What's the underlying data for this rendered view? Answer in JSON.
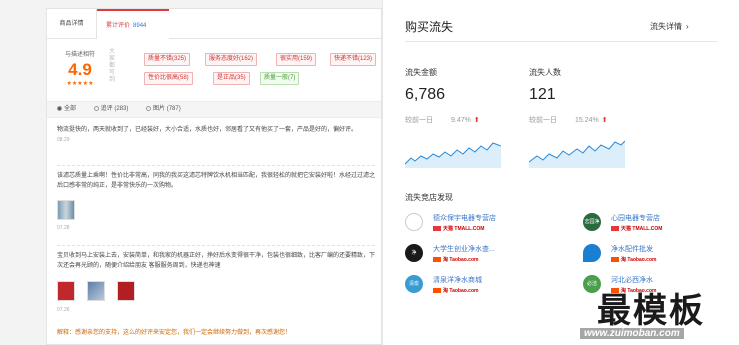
{
  "left_panel": {
    "tabs": [
      {
        "label": "商品详情"
      },
      {
        "label": "累计评价",
        "count": "8944"
      }
    ],
    "score": {
      "label": "与描述相符",
      "value": "4.9",
      "stars": "★★★★★"
    },
    "side_text": "大家都写到",
    "chips": [
      {
        "label": "质量不错(325)",
        "kind": "bad"
      },
      {
        "label": "服务态度好(162)",
        "kind": "bad"
      },
      {
        "label": "很实用(159)",
        "kind": "bad"
      },
      {
        "label": "快递不错(123)",
        "kind": "bad"
      },
      {
        "label": "性价比很高(58)",
        "kind": "bad"
      },
      {
        "label": "是正品(35)",
        "kind": "bad"
      },
      {
        "label": "质量一般(7)",
        "kind": "good"
      }
    ],
    "filter": {
      "all": "全部",
      "append": "追评 (283)",
      "pics": "图片 (787)"
    },
    "reviews": [
      {
        "text": "物流挺快的，两天就收到了，已经装好，大小合适，水质也好，邻居看了又有他买了一套，产品是好的，偏好评。",
        "date": "08.29"
      },
      {
        "text": "该滤芯质量上乘啊！性价比非常高，同我的我买这滤芯特牌饮水机相当匹配，我很轻松的就把它安装好啦！水经过过滤之后口感非常的纯正，是非常快乐的一次购物。",
        "date": "07.28"
      },
      {
        "text": "宝贝收到马上安装上去，安装简单，和我家的机器正好，挣好后水变得很干净，包装也很细致，比客厂编的还要精致，下次还会再光顾的，随便介绍给朋友 客服服务周到，快递也神速",
        "date": "07.26"
      }
    ],
    "reply": "解释：感谢亲您的支持，这么的好评来安定您，我们一定会继续努力做到，再次感谢您！"
  },
  "right_panel": {
    "title": "购买流失",
    "detail_link": "流失详情",
    "metrics": [
      {
        "label": "流失金额",
        "value": "6,786",
        "compare_label": "较前一日",
        "change": "9.47%"
      },
      {
        "label": "流失人数",
        "value": "121",
        "compare_label": "较前一日",
        "change": "15.24%"
      }
    ],
    "competitors_title": "流失竞店发现",
    "stores": [
      {
        "name": "德众保宇电器专营店",
        "platform": "天猫 TMALL.COM",
        "logo_color": "#ffffff",
        "logo_text": ""
      },
      {
        "name": "心园电器专营店",
        "platform": "天猫 TMALL.COM",
        "logo_color": "#2a6b3d",
        "logo_text": "志园净水"
      },
      {
        "name": "大学生创业净水查...",
        "platform": "淘 Taobao.com",
        "logo_color": "#1a1a1a",
        "logo_text": "净"
      },
      {
        "name": "净水配件批发",
        "platform": "淘 Taobao.com",
        "logo_color": "#1a7fd0",
        "logo_text": ""
      },
      {
        "name": "清泉洋净水商城",
        "platform": "淘 Taobao.com",
        "logo_color": "#3a9bd0",
        "logo_text": "清泉"
      },
      {
        "name": "河北必西净水",
        "platform": "淘 Taobao.com",
        "logo_color": "#4aa04a",
        "logo_text": "必洁"
      }
    ]
  },
  "watermark": {
    "text": "最模板",
    "url": "www.zuimoban.com"
  },
  "colors": {
    "accent": "#e4393c",
    "link": "#3a77c8",
    "spark": "#2b8ad9"
  }
}
